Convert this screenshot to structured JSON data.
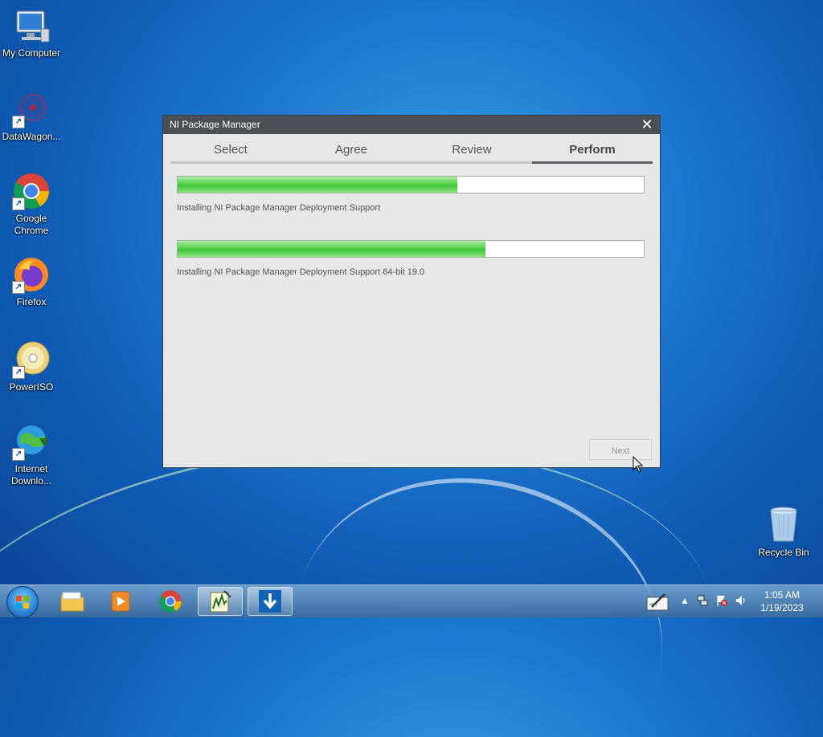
{
  "desktop": {
    "icons": [
      {
        "label": "My Computer"
      },
      {
        "label": "DataWagon..."
      },
      {
        "label": "Google Chrome"
      },
      {
        "label": "Firefox"
      },
      {
        "label": "PowerISO"
      },
      {
        "label": "Internet Downlo..."
      },
      {
        "label": "Recycle Bin"
      }
    ],
    "shortcut_glyph": "↗"
  },
  "window": {
    "title": "NI Package Manager",
    "close_glyph": "✕",
    "tabs": [
      {
        "label": "Select",
        "active": false
      },
      {
        "label": "Agree",
        "active": false
      },
      {
        "label": "Review",
        "active": false
      },
      {
        "label": "Perform",
        "active": true
      }
    ],
    "progress": [
      {
        "label": "Installing NI Package Manager Deployment Support",
        "percent": 60
      },
      {
        "label": "Installing NI Package Manager Deployment Support 64-bit 19.0",
        "percent": 66
      }
    ],
    "next_label": "Next"
  },
  "taskbar": {
    "time": "1:05 AM",
    "date": "1/19/2023",
    "tray_arrow": "▲"
  },
  "colors": {
    "progress_fill": "#4cc944",
    "titlebar": "#4a4f55"
  }
}
